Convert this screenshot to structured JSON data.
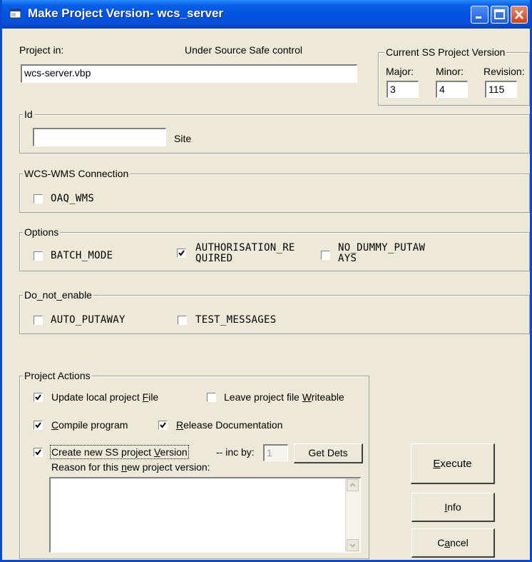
{
  "window": {
    "title": "Make Project Version- wcs_server"
  },
  "project": {
    "label": "Project in:",
    "status": "Under Source Safe control",
    "file_value": "wcs-server.vbp"
  },
  "version_group": {
    "legend": "Current SS Project Version",
    "major_label": "Major:",
    "minor_label": "Minor:",
    "revision_label": "Revision:",
    "major": "3",
    "minor": "4",
    "revision": "115"
  },
  "id_group": {
    "legend": "Id",
    "site_value": "",
    "site_label": "Site"
  },
  "wcs_group": {
    "legend": "WCS-WMS Connection",
    "oaq_label": "OAQ_WMS",
    "oaq_checked": false
  },
  "options_group": {
    "legend": "Options",
    "batch_label": "BATCH_MODE",
    "batch_checked": false,
    "auth_label_1": "AUTHORISATION_RE",
    "auth_label_2": "QUIRED",
    "auth_checked": true,
    "nodummy_label_1": "NO_DUMMY_PUTAW",
    "nodummy_label_2": "AYS",
    "nodummy_checked": false
  },
  "donot_group": {
    "legend": "Do_not_enable",
    "autoputaway_label": "AUTO_PUTAWAY",
    "autoputaway_checked": false,
    "testmsg_label": "TEST_MESSAGES",
    "testmsg_checked": false
  },
  "actions_group": {
    "legend": "Project Actions",
    "update_pre": "Update local project ",
    "update_key": "F",
    "update_post": "ile",
    "update_checked": true,
    "leave_pre": "Leave project file ",
    "leave_key": "W",
    "leave_post": "riteable",
    "leave_checked": false,
    "compile_key": "C",
    "compile_post": "ompile program",
    "compile_checked": true,
    "release_key": "R",
    "release_post": "elease Documentation",
    "release_checked": true,
    "create_pre": "Create new SS project ",
    "create_key": "V",
    "create_post": "ersion",
    "create_checked": true,
    "inc_label": "-- inc by:",
    "inc_value": "1",
    "getdets_label": "Get Dets",
    "reason_pre": "Reason for this ",
    "reason_key": "n",
    "reason_post": "ew project version:",
    "reason_value": ""
  },
  "buttons": {
    "execute_key": "E",
    "execute_post": "xecute",
    "info_key": "I",
    "info_post": "nfo",
    "cancel_pre": "C",
    "cancel_key": "a",
    "cancel_post": "ncel"
  },
  "colors": {
    "titlebar": "#0054e3",
    "face": "#ece9d8"
  }
}
